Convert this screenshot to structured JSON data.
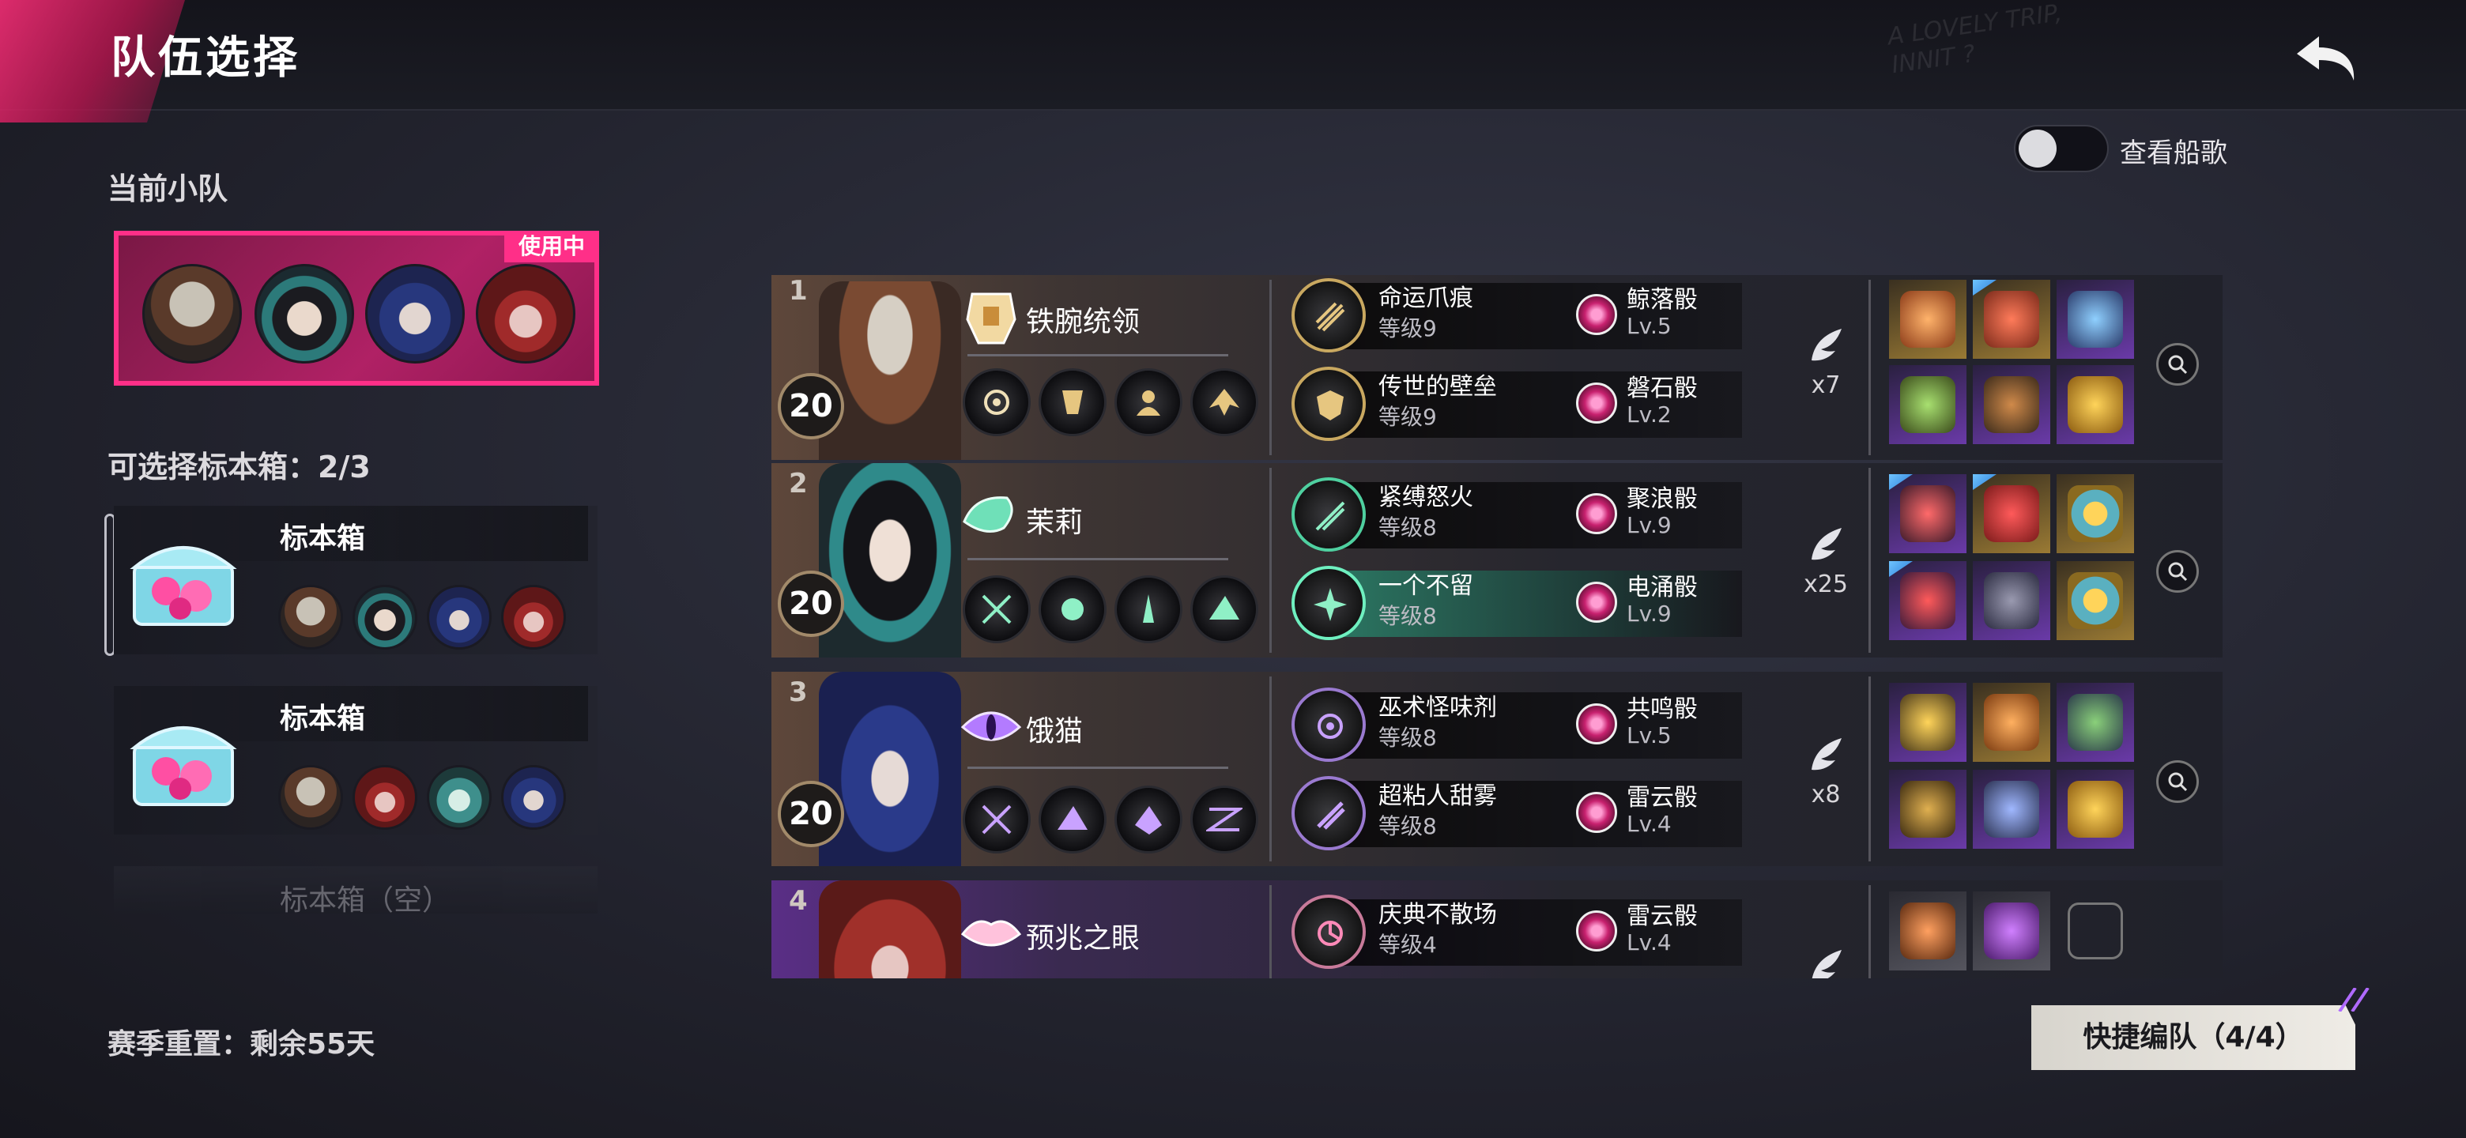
{
  "header": {
    "title": "队伍选择",
    "deco_text_1": "A LOVELY TRIP,",
    "deco_text_2": "INNIT ?"
  },
  "toggle": {
    "label": "查看船歌",
    "on": false
  },
  "current_squad": {
    "title": "当前小队",
    "badge": "使用中"
  },
  "specimen_section": {
    "title": "可选择标本箱：2/3"
  },
  "specimens": [
    {
      "name": "标本箱"
    },
    {
      "name": "标本箱"
    },
    {
      "name": "标本箱（空）"
    }
  ],
  "season": {
    "text": "赛季重置：剩余55天"
  },
  "quick_team": {
    "label": "快捷编队（4/4）"
  },
  "team": [
    {
      "index": "1",
      "level": "20",
      "character": "铁腕统领",
      "modules": [
        {
          "name": "命运爪痕",
          "level": "等级9",
          "die": "鲸落骰",
          "die_level": "Lv.5"
        },
        {
          "name": "传世的壁垒",
          "level": "等级9",
          "die": "磐石骰",
          "die_level": "Lv.2"
        }
      ],
      "bonus": "x7"
    },
    {
      "index": "2",
      "level": "20",
      "character": "茉莉",
      "modules": [
        {
          "name": "紧缚怒火",
          "level": "等级8",
          "die": "聚浪骰",
          "die_level": "Lv.9"
        },
        {
          "name": "一个不留",
          "level": "等级8",
          "die": "电涌骰",
          "die_level": "Lv.9"
        }
      ],
      "bonus": "x25"
    },
    {
      "index": "3",
      "level": "20",
      "character": "饿猫",
      "modules": [
        {
          "name": "巫术怪味剂",
          "level": "等级8",
          "die": "共鸣骰",
          "die_level": "Lv.5"
        },
        {
          "name": "超粘人甜雾",
          "level": "等级8",
          "die": "雷云骰",
          "die_level": "Lv.4"
        }
      ],
      "bonus": "x8"
    },
    {
      "index": "4",
      "level": "",
      "character": "预兆之眼",
      "modules": [
        {
          "name": "庆典不散场",
          "level": "等级4",
          "die": "雷云骰",
          "die_level": "Lv.4"
        }
      ],
      "bonus": ""
    }
  ],
  "colors": {
    "accent": "#ff2f88",
    "background": "#23242f",
    "gold": "#9a7a34",
    "purple": "#6a3aa8"
  },
  "icons": [
    "back-arrow-icon",
    "chest-icon",
    "feather-icon",
    "magnify-icon",
    "gauntlet-icon",
    "jade-icon",
    "cat-eye-icon",
    "lips-icon"
  ]
}
